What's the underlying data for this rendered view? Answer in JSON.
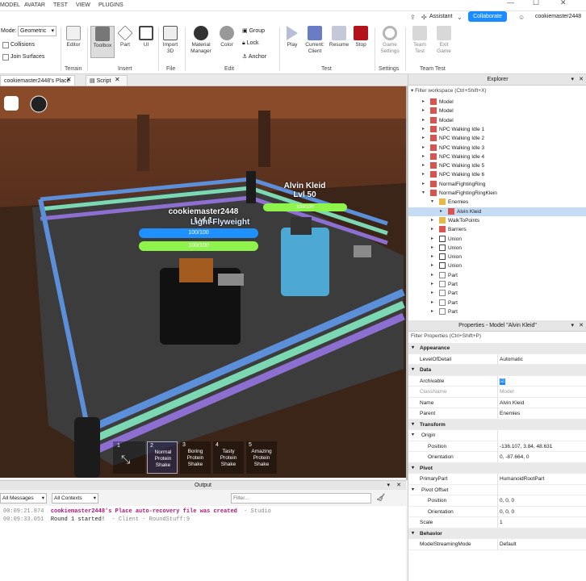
{
  "menubar": {
    "items": [
      "MODEL",
      "AVATAR",
      "TEST",
      "VIEW",
      "PLUGINS"
    ],
    "assistant": "Assistant",
    "collaborate": "Collaborate",
    "username": "cookiemaster2448"
  },
  "ribbon": {
    "mode_label": "Mode:",
    "mode_value": "Geometric",
    "collisions": "Collisions",
    "join_surfaces": "Join Surfaces",
    "tools": [
      "Editor",
      "Toolbox",
      "Part",
      "UI",
      "Import 3D",
      "Material Manager",
      "Color",
      "Group",
      "Lock",
      "Anchor",
      "Play",
      "Current: Client",
      "Resume",
      "Stop",
      "Game Settings",
      "Team Test",
      "Exit Game"
    ],
    "groups": [
      "Terrain",
      "Insert",
      "File",
      "Edit",
      "Test",
      "Settings",
      "Team Test"
    ]
  },
  "doc_tabs": [
    "cookiemaster2448's Place",
    "Script"
  ],
  "viewport": {
    "player_name": "cookiemaster2448",
    "player_lvl": "Lvl 1",
    "player_class": "Light Flyweight",
    "player_health": "100/100",
    "player_stamina": "100/100",
    "npc_name": "Alvin Kleid",
    "npc_lvl": "Lvl 50",
    "npc_stamina": "100/100",
    "hotbar": [
      {
        "n": "1",
        "label": ""
      },
      {
        "n": "2",
        "label": "Normal Protein Shake"
      },
      {
        "n": "3",
        "label": "Boring Protein Shake"
      },
      {
        "n": "4",
        "label": "Tasty Protein Shake"
      },
      {
        "n": "5",
        "label": "Amazing Protein Shake"
      }
    ]
  },
  "output": {
    "title": "Output",
    "filter1": "All Messages",
    "filter2": "All Contexts",
    "search_placeholder": "Filter...",
    "lines": [
      {
        "time": "00:09:21.874",
        "msg": "cookiemaster2448's Place auto-recovery file was created",
        "ctx": "- Studio",
        "color": "#b0147d"
      },
      {
        "time": "00:09:33.051",
        "msg": "Round 1 started!",
        "ctx": "- Client - RoundStuff:9",
        "color": "#222"
      }
    ]
  },
  "explorer": {
    "title": "Explorer",
    "filter": "Filter workspace (Ctrl+Shift+X)",
    "rows": [
      [
        "Model",
        1,
        "m"
      ],
      [
        "Model",
        1,
        "m"
      ],
      [
        "Model",
        1,
        "m"
      ],
      [
        "NPC Walking Idle 1",
        1,
        "m"
      ],
      [
        "NPC Walking Idle 2",
        1,
        "m"
      ],
      [
        "NPC Walking Idle 3",
        1,
        "m"
      ],
      [
        "NPC Walking Idle 4",
        1,
        "m"
      ],
      [
        "NPC Walking Idle 5",
        1,
        "m"
      ],
      [
        "NPC Walking Idle 6",
        1,
        "m"
      ],
      [
        "NormalFightingRing",
        1,
        "m"
      ],
      [
        "NormalFightingRingKlein",
        1,
        "m"
      ],
      [
        "Enemies",
        2,
        "f"
      ],
      [
        "Alvin Kleid",
        3,
        "m"
      ],
      [
        "WalkToPoints",
        2,
        "f"
      ],
      [
        "Barriers",
        2,
        "m"
      ],
      [
        "Union",
        2,
        "u"
      ],
      [
        "Union",
        2,
        "u"
      ],
      [
        "Union",
        2,
        "u"
      ],
      [
        "Union",
        2,
        "u"
      ],
      [
        "Part",
        2,
        "p"
      ],
      [
        "Part",
        2,
        "p"
      ],
      [
        "Part",
        2,
        "p"
      ],
      [
        "Part",
        2,
        "p"
      ],
      [
        "Part",
        2,
        "p"
      ]
    ]
  },
  "properties": {
    "title": "Properties - Model \"Alvin Kleid\"",
    "filter": "Filter Properties (Ctrl+Shift+P)",
    "rows": [
      [
        "cat",
        "Appearance",
        ""
      ],
      [
        "p",
        "LevelOfDetail",
        "Automatic"
      ],
      [
        "cat",
        "Data",
        ""
      ],
      [
        "p",
        "Archivable",
        "☑"
      ],
      [
        "p",
        "ClassName",
        "Model"
      ],
      [
        "p",
        "Name",
        "Alvin Kleid"
      ],
      [
        "p",
        "Parent",
        "Enemies"
      ],
      [
        "cat",
        "Transform",
        ""
      ],
      [
        "p",
        "Origin",
        ""
      ],
      [
        "p",
        "Position",
        "-136.107, 3.84, 48.631"
      ],
      [
        "p",
        "Orientation",
        "0, -87.664, 0"
      ],
      [
        "cat",
        "Pivot",
        ""
      ],
      [
        "p",
        "PrimaryPart",
        "HumanoidRootPart"
      ],
      [
        "p",
        "Pivot Offset",
        ""
      ],
      [
        "p",
        "Position",
        "0, 0, 0"
      ],
      [
        "p",
        "Orientation",
        "0, 0, 0"
      ],
      [
        "p",
        "Scale",
        "1"
      ],
      [
        "cat",
        "Behavior",
        ""
      ],
      [
        "p",
        "ModelStreamingMode",
        "Default"
      ]
    ]
  }
}
